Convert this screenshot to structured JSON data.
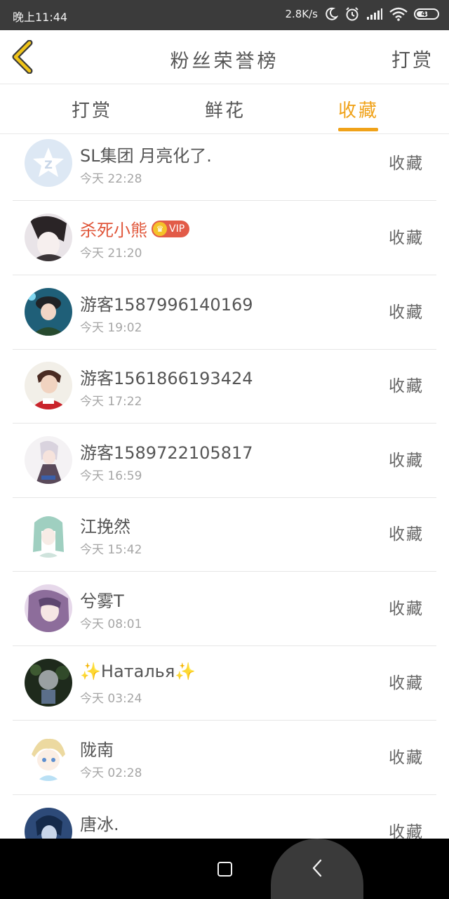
{
  "status_bar": {
    "time": "晚上11:44",
    "net_speed": "2.8K/s",
    "battery_level": "46"
  },
  "header": {
    "title": "粉丝荣誉榜",
    "right_action": "打赏"
  },
  "tabs": [
    {
      "label": "打赏",
      "active": false
    },
    {
      "label": "鲜花",
      "active": false
    },
    {
      "label": "收藏",
      "active": true
    }
  ],
  "colors": {
    "accent": "#f0a219",
    "vip_name": "#e0563a",
    "vip_badge": "#e25b48"
  },
  "vip_label": "VIP",
  "entries": [
    {
      "name": "SL集团 月亮化了.",
      "time": "今天 22:28",
      "action": "收藏"
    },
    {
      "name": "杀死小熊",
      "time": "今天 21:20",
      "action": "收藏"
    },
    {
      "name": "游客1587996140169",
      "time": "今天 19:02",
      "action": "收藏"
    },
    {
      "name": "游客1561866193424",
      "time": "今天 17:22",
      "action": "收藏"
    },
    {
      "name": "游客1589722105817",
      "time": "今天 16:59",
      "action": "收藏"
    },
    {
      "name": "江挽然",
      "time": "今天 15:42",
      "action": "收藏"
    },
    {
      "name": "兮雾T",
      "time": "今天 08:01",
      "action": "收藏"
    },
    {
      "name": "Наталья",
      "time": "今天 03:24",
      "action": "收藏"
    },
    {
      "name": "陇南",
      "time": "今天 02:28",
      "action": "收藏"
    },
    {
      "name": "唐冰.",
      "time": "",
      "action": "收藏"
    }
  ]
}
